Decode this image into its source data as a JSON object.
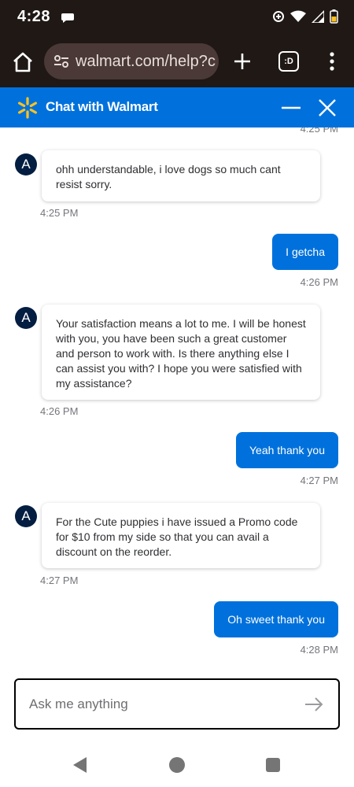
{
  "status_bar": {
    "time": "4:28"
  },
  "browser": {
    "url": "walmart.com/help?c",
    "tabs_icon_text": ":D"
  },
  "chat_header": {
    "title": "Chat with Walmart"
  },
  "chat": {
    "cut_timestamp": "4:25 PM",
    "avatar_letter": "A",
    "messages": [
      {
        "sender": "agent",
        "text": "ohh understandable, i love dogs so much cant resist sorry.",
        "time": "4:25 PM"
      },
      {
        "sender": "user",
        "text": "I getcha",
        "time": "4:26 PM"
      },
      {
        "sender": "agent",
        "text": "Your satisfaction means a lot to me. I will be honest with you, you have been such a great customer and person to work with. Is there anything else I can assist you with? I hope you were satisfied with my assistance?",
        "time": "4:26 PM"
      },
      {
        "sender": "user",
        "text": "Yeah thank you",
        "time": "4:27 PM"
      },
      {
        "sender": "agent",
        "text": "For the Cute puppies i have issued a Promo code for $10 from my side so that you can avail a discount on the reorder.",
        "time": "4:27 PM"
      },
      {
        "sender": "user",
        "text": "Oh sweet thank you",
        "time": "4:28 PM"
      }
    ]
  },
  "input": {
    "placeholder": "Ask me anything",
    "value": ""
  },
  "colors": {
    "walmart_blue": "#0071dc",
    "spark_yellow": "#ffc220",
    "avatar_navy": "#041e42",
    "browser_dark": "#1f1815"
  },
  "icons": [
    "chat-bubble-icon",
    "wifi-icon",
    "signal-icon",
    "battery-icon",
    "home-icon",
    "tune-icon",
    "plus-icon",
    "tabs-icon",
    "more-vert-icon",
    "walmart-spark-icon",
    "minimize-icon",
    "close-icon",
    "arrow-right-icon",
    "back-triangle-icon",
    "home-circle-icon",
    "recents-square-icon"
  ]
}
